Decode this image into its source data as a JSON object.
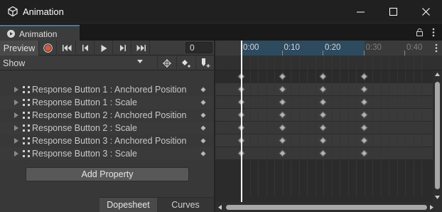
{
  "window": {
    "title": "Animation",
    "controls": [
      "minimize-icon",
      "maximize-icon",
      "close-icon"
    ]
  },
  "tab": {
    "label": "Animation",
    "icon": "animation-icon"
  },
  "toolbar": {
    "preview_label": "Preview",
    "buttons": [
      "record-icon",
      "first-keyframe-icon",
      "previous-keyframe-icon",
      "play-icon",
      "next-keyframe-icon",
      "last-keyframe-icon"
    ],
    "frame_value": "0",
    "record_color": "#e0533b"
  },
  "filter": {
    "show_value": "Show",
    "buttons": [
      "filter-icon",
      "add-keyframe-icon",
      "add-event-icon"
    ]
  },
  "properties": [
    {
      "label": "Response Button 1 : Anchored Position"
    },
    {
      "label": "Response Button 1 : Scale"
    },
    {
      "label": "Response Button 2 : Anchored Position"
    },
    {
      "label": "Response Button 2 : Scale"
    },
    {
      "label": "Response Button 3 : Anchored Position"
    },
    {
      "label": "Response Button 3 : Scale"
    }
  ],
  "add_property_label": "Add Property",
  "view_tabs": {
    "dopesheet": "Dopesheet",
    "curves": "Curves",
    "active": "Dopesheet"
  },
  "timeline": {
    "tick_labels": [
      "0:00",
      "0:10",
      "0:20",
      "0:30",
      "0:40"
    ],
    "active_range_color": "#2d4a5f",
    "playhead_time": "0:00",
    "keyframe_times": [
      "0:00",
      "0:10",
      "0:20",
      "0:30"
    ]
  },
  "colors": {
    "accent": "#3a79bb",
    "window_bg": "#383838",
    "playhead": "#ffffff"
  }
}
